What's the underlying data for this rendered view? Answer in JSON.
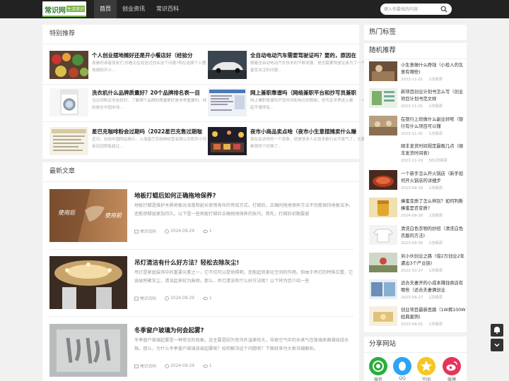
{
  "header": {
    "logo_main": "常识网",
    "logo_tag": "生活常识",
    "nav": [
      "首页",
      "创业资讯",
      "常识百科"
    ],
    "search_placeholder": "键入你要找的内容"
  },
  "featured": {
    "title": "特别推荐",
    "items": [
      {
        "title": "个人创业摆地摊好还是开小餐店好（经验分",
        "desc": "肯素的读者朋友们,你看见在经验过创业这个问题?你在选择个人摆地摊和开小..."
      },
      {
        "title": "全自动电动汽车需要驾驶证吗？要的，原因在",
        "desc": "随着全自动电动汽车技术的不断发展，是否需要驾驶证成为了一个备受关注的问题..."
      },
      {
        "title": "洗衣机什么品牌质量好？20个品牌排名表一目",
        "desc": "当达到购买洗衣机时，了解哪个品牌的质量更好是非常重要的。特别是在中国市场..."
      },
      {
        "title": "网上兼职靠谱吗（网络兼职平台和抄写员兼职",
        "desc": "网上兼职靠谱吗不受时间和地点的限制，但写定世界进入都　　一起不懂得有..."
      },
      {
        "title": "星巴克咖啡粉会过期吗（2022星巴克售过期咖",
        "desc": "近日，包括中国网站报示，上海星巴克咖啡经营有限公司机件小河商店因销售超过..."
      },
      {
        "title": "夜市小商品卖点啥（夜市小生意摆摊卖什么赚",
        "desc": "现在有这样的一个现象，就是很多人在张多数行业不景气了，大家都想找个好做了..."
      }
    ]
  },
  "latest": {
    "title": "最新文章",
    "items": [
      {
        "title": "地板打蜡后如何正确拖地保养?",
        "desc": "地板打蜡是维护木质地板光泽度和延长使用寿命的有效方式。打蜡后，正确的拖地保养方法不仅能保持地板洁净，还能使蜡层更加持久。以下是一些地板打蜡后正确拖地保养的技巧。首先，打蜡后初期要避",
        "category": "常识百科",
        "date": "2024-09-29",
        "views": "1",
        "img_before": "使用后",
        "img_after": "使用前"
      },
      {
        "title": "吊灯清洁有什么好方法？轻松去除灰尘!",
        "desc": "吊灯是家庭装饰中的重要元素之一，它不仅可以提供照明，还能起到美化空间的作用。但由于吊灯的特殊位置，它容易积聚灰尘，清洁起来较为麻烦。那么，吊灯清洁有什么好方法呢？以下将为您介绍一些",
        "category": "常识百科",
        "date": "2024-09-29",
        "views": "1"
      },
      {
        "title": "冬季窗户玻璃为何会起雾?",
        "desc": "冬季窗户玻璃起雾是一种常见的现象。这主要是因为室内外温差较大，导致空气中的水蒸气在玻璃表面凝结成水珠。那么，为什么冬季窗户玻璃容易起雾呢？如何解决这个问题呢？下面就来为大家详细解析。",
        "category": "常识百科",
        "date": "2024-09-29",
        "views": "1"
      }
    ]
  },
  "sidebar": {
    "tags_title": "热门标签",
    "random_title": "随机推荐",
    "random": [
      {
        "title": "小生意做什么挣钱（小投入的生意有哪些)",
        "date": "2023-11-01",
        "reads": "1次阅读"
      },
      {
        "title": "新项目创业计划书怎么写（创业项目计划书范文样",
        "date": "2023-11-01",
        "reads": "1次阅读"
      },
      {
        "title": "在银行上班做什么副业好呢（银行有什么项目可以赚",
        "date": "2023-11-01",
        "reads": "1次阅读"
      },
      {
        "title": "顺丰发货时间规定最晚几点（顺丰发货时间表)",
        "date": "2023-11-29",
        "reads": "582次阅读"
      },
      {
        "title": "一个新手怎么开火锅店（新手如何开火锅店的详细步",
        "date": "2023-09-18",
        "reads": "1次阅读"
      },
      {
        "title": "蜂蜜变质了怎么辨别？如何判断蜂蜜是否变质?",
        "date": "2024-09-26",
        "reads": "1次阅读"
      },
      {
        "title": "清洗白色衣物的妙招（清洗白色衣服的方法)",
        "date": "2023-09-05",
        "reads": "1次阅读"
      },
      {
        "title": "另小伙创业之路（借2万创业2年遭出3个产业链)",
        "date": "2022-10-27",
        "reads": "1次阅读"
      },
      {
        "title": "适合夫妻开的小成本赚钱商店有哪些（适合夫妻俩创业",
        "date": "2023-09-27",
        "reads": "1次阅读"
      },
      {
        "title": "创业项目最新思路（1W揭100W经典案例)",
        "date": "2023-09-01",
        "reads": "1次阅读"
      }
    ],
    "share_title": "分享网站",
    "share": [
      {
        "label": "微信",
        "color": "#2aae3b"
      },
      {
        "label": "QQ",
        "color": "#2ba4f5"
      },
      {
        "label": "空间",
        "color": "#f6c624"
      },
      {
        "label": "微博",
        "color": "#e6345a"
      }
    ]
  }
}
